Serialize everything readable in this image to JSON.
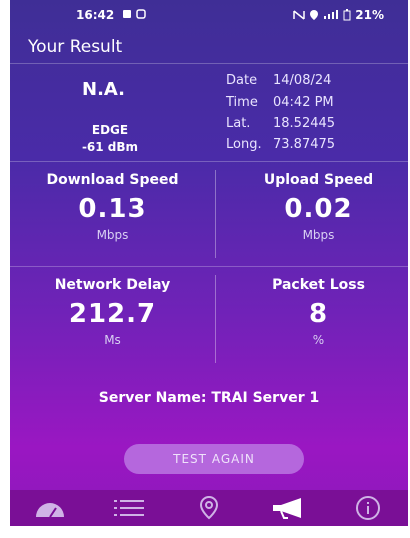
{
  "status_bar": {
    "time": "16:42",
    "battery": "21%"
  },
  "header": {
    "title": "Your Result"
  },
  "info": {
    "operator": "N.A.",
    "technology": "EDGE",
    "signal": "-61 dBm",
    "date_label": "Date",
    "date_value": "14/08/24",
    "time_label": "Time",
    "time_value": "04:42 PM",
    "lat_label": "Lat.",
    "lat_value": "18.52445",
    "long_label": "Long.",
    "long_value": "73.87475"
  },
  "download": {
    "label": "Download Speed",
    "value": "0.13",
    "unit": "Mbps"
  },
  "upload": {
    "label": "Upload Speed",
    "value": "0.02",
    "unit": "Mbps"
  },
  "delay": {
    "label": "Network Delay",
    "value": "212.7",
    "unit": "Ms"
  },
  "loss": {
    "label": "Packet Loss",
    "value": "8",
    "unit": "%"
  },
  "server": {
    "text": "Server Name: TRAI Server 1"
  },
  "button": {
    "label": "TEST AGAIN"
  },
  "nav_icons": [
    "speedometer-icon",
    "list-icon",
    "location-pin-icon",
    "megaphone-icon",
    "info-icon"
  ],
  "colors": {
    "gradient_top": "#3f2e96",
    "gradient_bottom": "#9a17c2",
    "button": "#b567dd",
    "nav": "#7a0f96"
  }
}
